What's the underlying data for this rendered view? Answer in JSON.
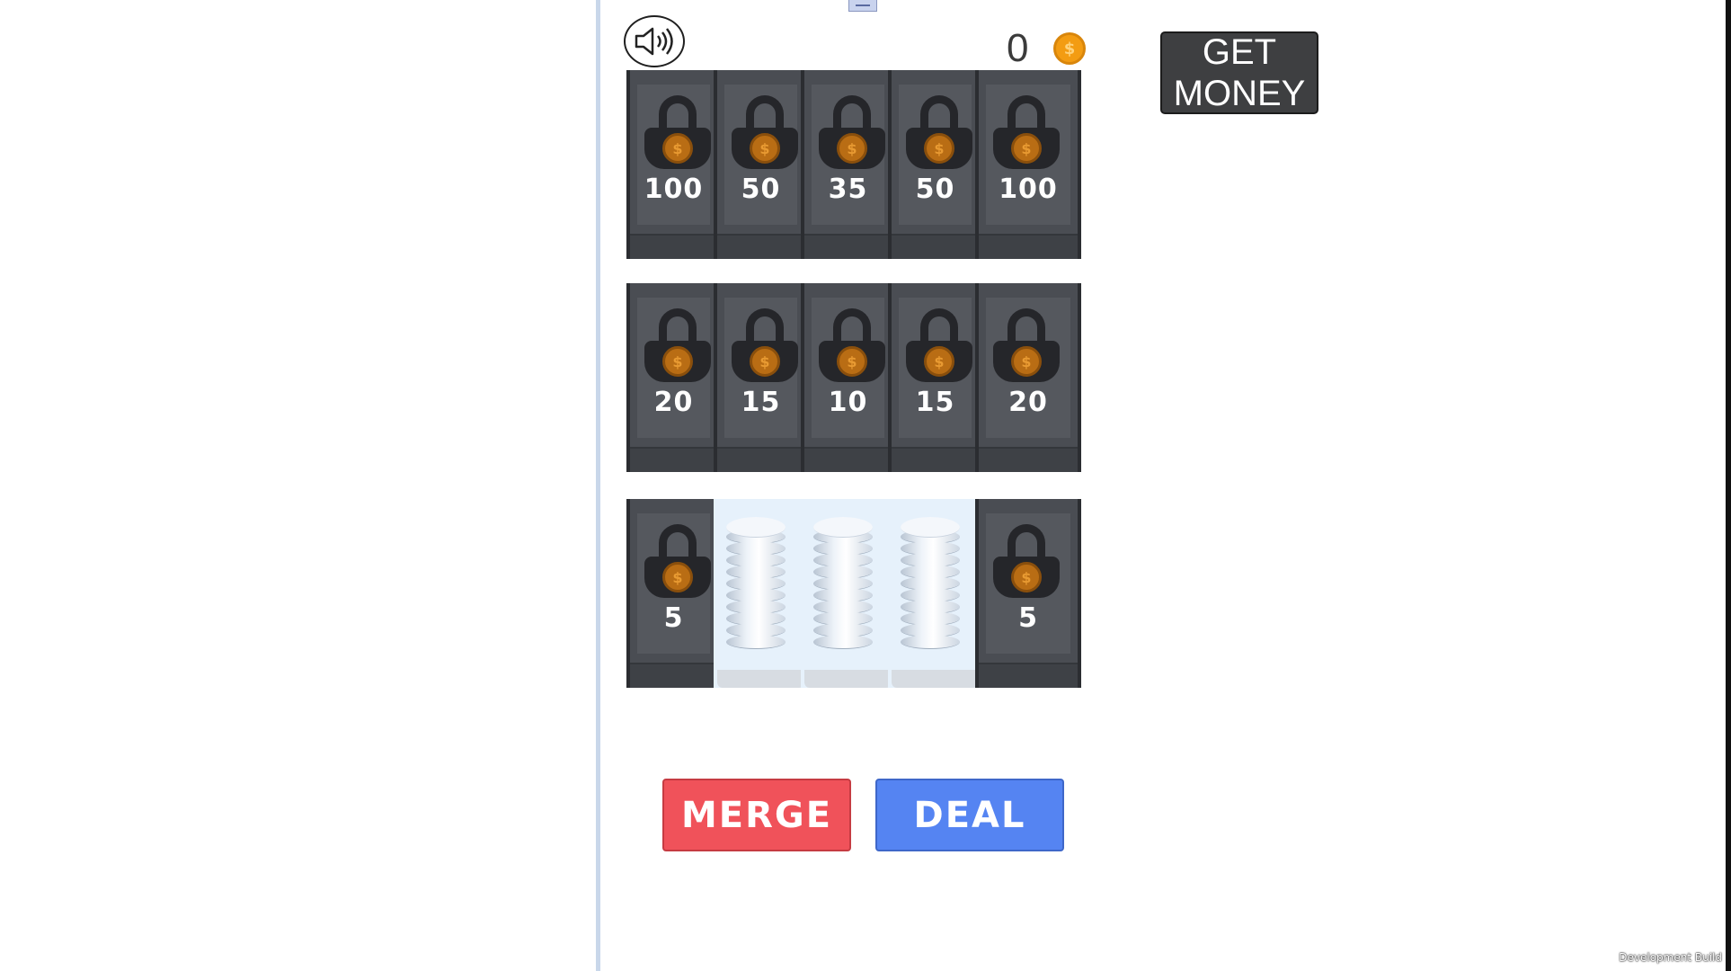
{
  "hud": {
    "coin_count": "0",
    "coin_icon": "coin-icon",
    "sound_icon": "speaker-icon",
    "get_money_label": "GET MONEY"
  },
  "board": {
    "rows": [
      {
        "slots": [
          {
            "state": "locked",
            "price": "100"
          },
          {
            "state": "locked",
            "price": "50"
          },
          {
            "state": "locked",
            "price": "35"
          },
          {
            "state": "locked",
            "price": "50"
          },
          {
            "state": "locked",
            "price": "100"
          }
        ]
      },
      {
        "slots": [
          {
            "state": "locked",
            "price": "20"
          },
          {
            "state": "locked",
            "price": "15"
          },
          {
            "state": "locked",
            "price": "10"
          },
          {
            "state": "locked",
            "price": "15"
          },
          {
            "state": "locked",
            "price": "20"
          }
        ]
      },
      {
        "slots": [
          {
            "state": "locked",
            "price": "5"
          },
          {
            "state": "open",
            "coin_stack": "white"
          },
          {
            "state": "open",
            "coin_stack": "white"
          },
          {
            "state": "open",
            "coin_stack": "white"
          },
          {
            "state": "locked",
            "price": "5"
          }
        ]
      }
    ]
  },
  "actions": {
    "merge_label": "MERGE",
    "deal_label": "DEAL"
  },
  "footer": {
    "watermark": "Development Build"
  },
  "colors": {
    "merge": "#f0525a",
    "deal": "#5584f2",
    "slot_locked": "#4a4d53",
    "coin": "#f39c12"
  }
}
